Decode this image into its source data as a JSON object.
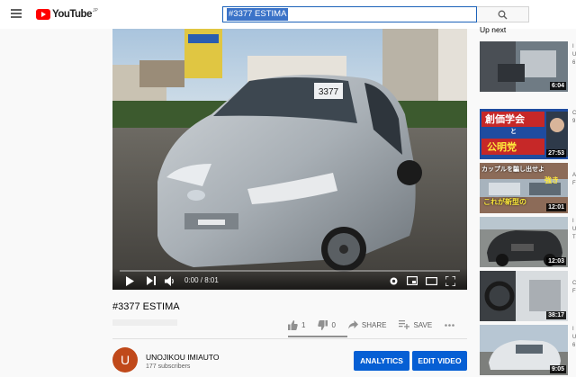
{
  "header": {
    "logo_text": "YouTube",
    "logo_sup": "JP",
    "search_value": "#3377 ESTIMA"
  },
  "player": {
    "time": "0:00 / 8:01",
    "plate_text": "3377",
    "controls": [
      "play-icon",
      "next-icon",
      "volume-icon",
      "settings-icon",
      "miniplayer-icon",
      "theater-icon",
      "fullscreen-icon"
    ]
  },
  "video": {
    "title": "#3377 ESTIMA",
    "likes": "1",
    "dislikes": "0",
    "share_label": "SHARE",
    "save_label": "SAVE"
  },
  "channel": {
    "avatar_letter": "U",
    "name": "UNOJIKOU IMIAUTO",
    "subscribers": "177 subscribers",
    "analytics_label": "ANALYTICS",
    "edit_label": "EDIT VIDEO"
  },
  "up_next": {
    "label": "Up next",
    "items": [
      {
        "duration": "6:04",
        "meta": [
          "I",
          "U",
          "6"
        ]
      },
      {
        "duration": "27:53",
        "overlay_top": "創価学会",
        "overlay_mid": "と",
        "overlay_bot": "公明党",
        "meta": [
          "",
          "C",
          "9"
        ]
      },
      {
        "duration": "12:01",
        "overlay_top": "カップルを騙し出せよ",
        "overlay_mid": "強き",
        "overlay_bot": "これが新型の",
        "meta": [
          "【",
          "A",
          "F"
        ]
      },
      {
        "duration": "12:03",
        "meta": [
          "I",
          "U",
          "T"
        ]
      },
      {
        "duration": "38:17",
        "meta": [
          "【",
          "C",
          "F"
        ]
      },
      {
        "duration": "9:05",
        "meta": [
          "I",
          "U",
          "6"
        ]
      }
    ]
  },
  "colors": {
    "accent": "#065fd4",
    "brand": "#ff0000",
    "avatar": "#c0491a"
  }
}
